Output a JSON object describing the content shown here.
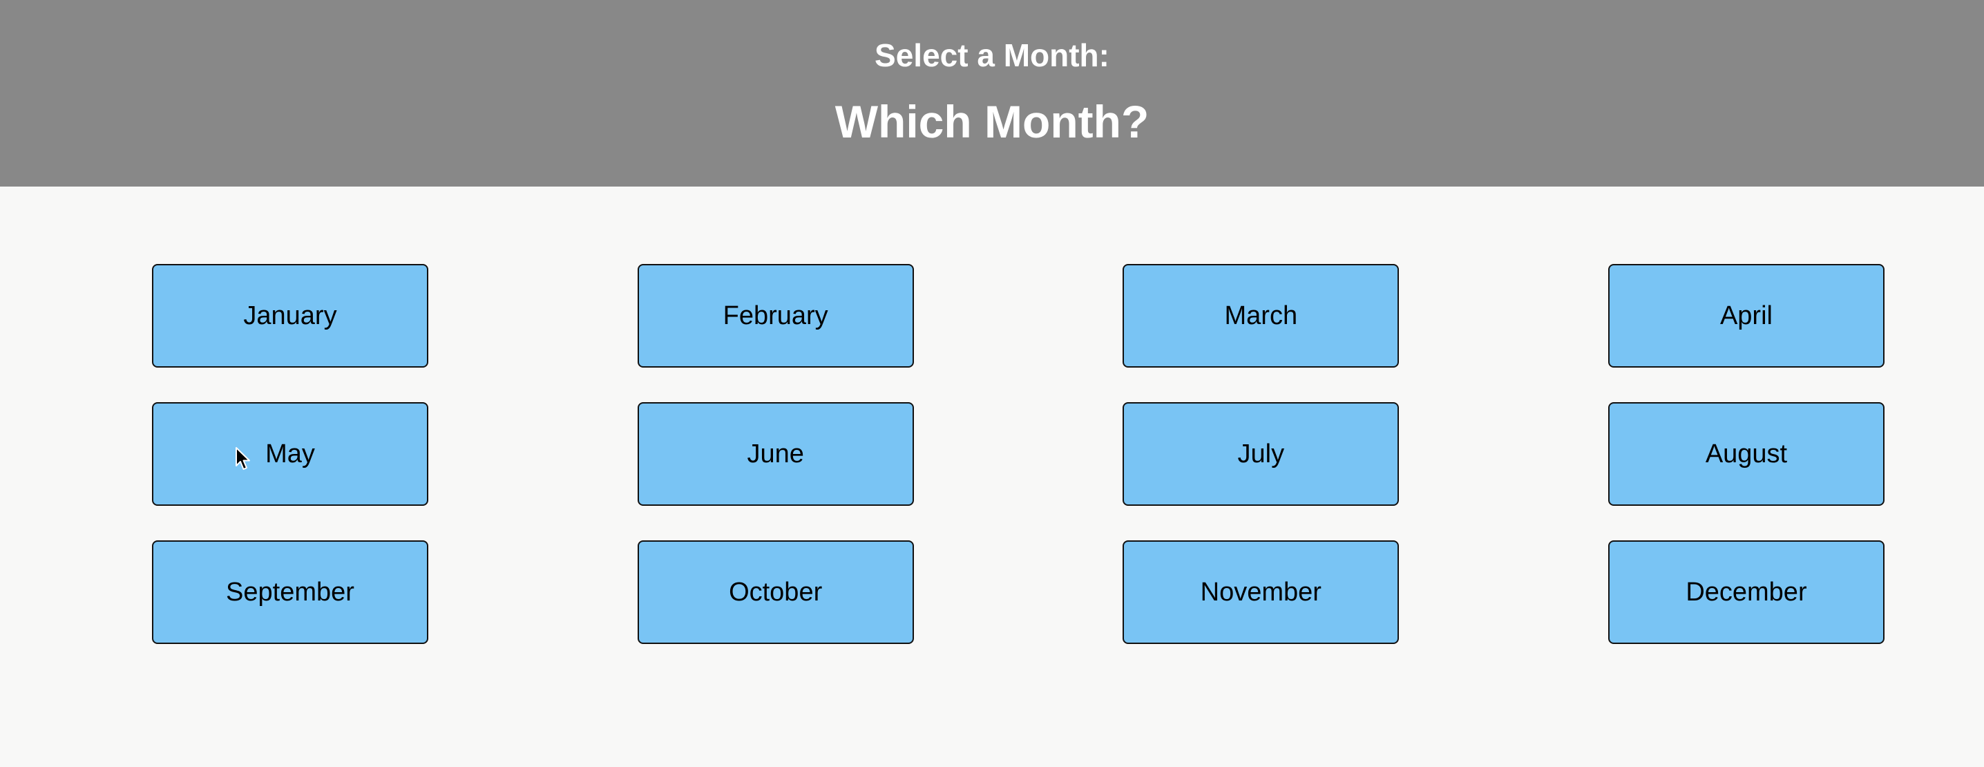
{
  "header": {
    "subtitle": "Select a Month:",
    "title": "Which Month?"
  },
  "months": [
    "January",
    "February",
    "March",
    "April",
    "May",
    "June",
    "July",
    "August",
    "September",
    "October",
    "November",
    "December"
  ],
  "colors": {
    "header_bg": "#888888",
    "page_bg": "#f8f8f7",
    "button_bg": "#79c4f4",
    "button_border": "#111111"
  },
  "icons": {
    "cursor": "mouse-pointer-icon"
  }
}
